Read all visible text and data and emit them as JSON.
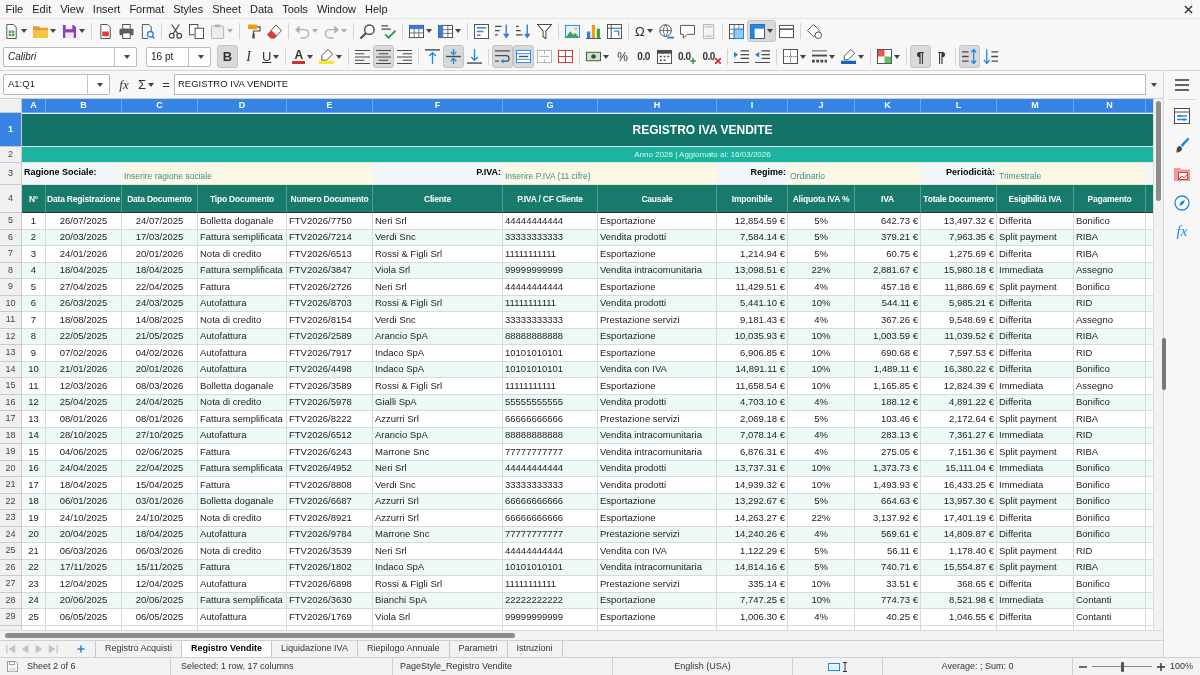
{
  "menu_bar": [
    "File",
    "Edit",
    "View",
    "Insert",
    "Format",
    "Styles",
    "Sheet",
    "Data",
    "Tools",
    "Window",
    "Help"
  ],
  "standard_toolbar": {
    "groups": [
      [
        {
          "kind": "new",
          "on": false,
          "disabled": false
        },
        {
          "kind": "open",
          "on": false,
          "disabled": false
        },
        {
          "kind": "save",
          "on": false,
          "disabled": false
        }
      ],
      [
        {
          "kind": "export-pdf",
          "on": false,
          "disabled": false
        },
        {
          "kind": "print",
          "on": false,
          "disabled": false
        },
        {
          "kind": "print-preview",
          "on": false,
          "disabled": false
        }
      ],
      [
        {
          "kind": "cut",
          "on": false,
          "disabled": false
        },
        {
          "kind": "copy",
          "on": false,
          "disabled": false
        },
        {
          "kind": "paste",
          "on": false,
          "disabled": true
        }
      ],
      [
        {
          "kind": "clone-formatting",
          "on": false,
          "disabled": false
        },
        {
          "kind": "clear-formatting",
          "on": false,
          "disabled": false
        }
      ],
      [
        {
          "kind": "undo",
          "on": false,
          "disabled": true
        },
        {
          "kind": "redo",
          "on": false,
          "disabled": true
        }
      ],
      [
        {
          "kind": "find-replace",
          "on": false,
          "disabled": false
        },
        {
          "kind": "spelling",
          "on": false,
          "disabled": false
        }
      ],
      [
        {
          "kind": "rows",
          "on": false,
          "disabled": false
        },
        {
          "kind": "columns",
          "on": false,
          "disabled": false
        }
      ],
      [
        {
          "kind": "sort",
          "on": false,
          "disabled": false
        },
        {
          "kind": "sort-ascending",
          "on": false,
          "disabled": false
        },
        {
          "kind": "sort-descending",
          "on": false,
          "disabled": false
        },
        {
          "kind": "autofilter",
          "on": false,
          "disabled": false
        }
      ],
      [
        {
          "kind": "image",
          "on": false,
          "disabled": false
        },
        {
          "kind": "chart",
          "on": false,
          "disabled": false
        },
        {
          "kind": "pivot-table",
          "on": false,
          "disabled": false
        }
      ],
      [
        {
          "kind": "special-character",
          "glyph": "Ω",
          "on": false,
          "disabled": false
        },
        {
          "kind": "hyperlink",
          "on": false,
          "disabled": false
        },
        {
          "kind": "comment",
          "on": false,
          "disabled": false
        },
        {
          "kind": "headers-footers",
          "on": false,
          "disabled": true
        }
      ],
      [
        {
          "kind": "print-area",
          "on": false,
          "disabled": false
        },
        {
          "kind": "freeze",
          "on": true,
          "disabled": false
        },
        {
          "kind": "split-window",
          "on": false,
          "disabled": false
        }
      ],
      [
        {
          "kind": "draw-functions",
          "on": false,
          "disabled": false
        }
      ]
    ]
  },
  "formatting_toolbar": {
    "font_name": "Calibri",
    "font_size": "16 pt",
    "groups": [
      [
        {
          "kind": "bold",
          "glyph": "B",
          "on": true,
          "disabled": false
        },
        {
          "kind": "italic",
          "glyph": "I",
          "on": false,
          "disabled": false
        },
        {
          "kind": "underline",
          "glyph": "U",
          "on": false,
          "disabled": false
        }
      ],
      [
        {
          "kind": "font-color",
          "glyph": "A",
          "on": false,
          "disabled": false
        },
        {
          "kind": "highlight",
          "on": false,
          "disabled": false
        }
      ],
      [
        {
          "kind": "align-left",
          "on": false,
          "disabled": false
        },
        {
          "kind": "align-center",
          "on": true,
          "disabled": false
        },
        {
          "kind": "align-right",
          "on": false,
          "disabled": false
        }
      ],
      [
        {
          "kind": "align-top",
          "on": false,
          "disabled": false
        },
        {
          "kind": "align-middle",
          "on": true,
          "disabled": false
        },
        {
          "kind": "align-bottom",
          "on": false,
          "disabled": false
        }
      ],
      [
        {
          "kind": "wrap-text",
          "on": true,
          "disabled": false
        },
        {
          "kind": "merge-center",
          "on": true,
          "disabled": false
        },
        {
          "kind": "merge-cells",
          "on": false,
          "disabled": true
        },
        {
          "kind": "unmerge-cells",
          "on": false,
          "disabled": false
        }
      ],
      [
        {
          "kind": "currency",
          "on": false,
          "disabled": false
        },
        {
          "kind": "percent",
          "glyph": "%",
          "on": false,
          "disabled": false
        },
        {
          "kind": "number-format",
          "glyph": "0.0",
          "on": false,
          "disabled": false
        },
        {
          "kind": "date-format",
          "on": false,
          "disabled": false
        },
        {
          "kind": "add-decimal",
          "glyph": "0.0",
          "on": false,
          "disabled": false
        },
        {
          "kind": "delete-decimal",
          "glyph": "0.0",
          "on": false,
          "disabled": false
        }
      ],
      [
        {
          "kind": "increase-indent",
          "on": false,
          "disabled": false
        },
        {
          "kind": "decrease-indent",
          "on": false,
          "disabled": false
        }
      ],
      [
        {
          "kind": "borders",
          "on": false,
          "disabled": false
        },
        {
          "kind": "border-style",
          "on": false,
          "disabled": false
        },
        {
          "kind": "border-color",
          "on": false,
          "disabled": false
        }
      ],
      [
        {
          "kind": "conditional",
          "on": false,
          "disabled": false
        }
      ],
      [
        {
          "kind": "left-to-right",
          "glyph": "¶",
          "on": true,
          "disabled": false
        },
        {
          "kind": "right-to-left",
          "glyph": "¶",
          "on": false,
          "disabled": false
        }
      ],
      [
        {
          "kind": "text-stack",
          "on": true,
          "disabled": false
        },
        {
          "kind": "text-down",
          "on": false,
          "disabled": false
        }
      ]
    ]
  },
  "formula_bar": {
    "name_box": "A1:Q1",
    "buttons": [
      {
        "kind": "function-wizard",
        "glyph": "fx"
      },
      {
        "kind": "sum",
        "glyph": "Σ"
      },
      {
        "kind": "formula",
        "glyph": "="
      }
    ],
    "content": "REGISTRO IVA VENDITE"
  },
  "sheet": {
    "column_headers": [
      {
        "label": "A",
        "selected": true
      },
      {
        "label": "B",
        "selected": true
      },
      {
        "label": "C",
        "selected": true
      },
      {
        "label": "D",
        "selected": true
      },
      {
        "label": "E",
        "selected": true
      },
      {
        "label": "F",
        "selected": true
      },
      {
        "label": "G",
        "selected": true
      },
      {
        "label": "H",
        "selected": true
      },
      {
        "label": "I",
        "selected": true
      },
      {
        "label": "J",
        "selected": true
      },
      {
        "label": "K",
        "selected": true
      },
      {
        "label": "L",
        "selected": true
      },
      {
        "label": "M",
        "selected": true
      },
      {
        "label": "N",
        "selected": true
      }
    ],
    "row_headers": [
      {
        "label": "1",
        "selected": true
      },
      {
        "label": "2",
        "selected": false
      },
      {
        "label": "3",
        "selected": false
      },
      {
        "label": "4",
        "selected": false
      },
      {
        "label": "5",
        "selected": false
      },
      {
        "label": "6",
        "selected": false
      },
      {
        "label": "7",
        "selected": false
      },
      {
        "label": "8",
        "selected": false
      },
      {
        "label": "9",
        "selected": false
      },
      {
        "label": "10",
        "selected": false
      },
      {
        "label": "11",
        "selected": false
      },
      {
        "label": "12",
        "selected": false
      },
      {
        "label": "13",
        "selected": false
      },
      {
        "label": "14",
        "selected": false
      },
      {
        "label": "15",
        "selected": false
      },
      {
        "label": "16",
        "selected": false
      },
      {
        "label": "17",
        "selected": false
      },
      {
        "label": "18",
        "selected": false
      },
      {
        "label": "19",
        "selected": false
      },
      {
        "label": "20",
        "selected": false
      },
      {
        "label": "21",
        "selected": false
      },
      {
        "label": "22",
        "selected": false
      },
      {
        "label": "23",
        "selected": false
      },
      {
        "label": "24",
        "selected": false
      },
      {
        "label": "25",
        "selected": false
      },
      {
        "label": "26",
        "selected": false
      },
      {
        "label": "27",
        "selected": false
      },
      {
        "label": "28",
        "selected": false
      },
      {
        "label": "29",
        "selected": false
      }
    ],
    "title": "REGISTRO IVA VENDITE",
    "subtitle": "Anno 2026 | Aggiornato al: 16/03/2026",
    "info_fields": [
      {
        "label": "Ragione Sociale:",
        "value": "Inserire ragione sociale"
      },
      {
        "label": "P.IVA:",
        "value": "Inserire P.IVA (11 cifre)"
      },
      {
        "label": "Regime:",
        "value": "Ordinario"
      },
      {
        "label": "Periodicità:",
        "value": "Trimestrale"
      }
    ],
    "columns": [
      "N°",
      "Data Registrazione",
      "Data Documento",
      "Tipo Documento",
      "Numero Documento",
      "Cliente",
      "P.IVA / CF Cliente",
      "Causale",
      "Imponibile",
      "Aliquota IVA %",
      "IVA",
      "Totale Documento",
      "Esigibilità IVA",
      "Pagamento"
    ],
    "rows": [
      [
        "1",
        "26/07/2025",
        "24/07/2025",
        "Bolletta doganale",
        "FTV2026/7750",
        "Neri Srl",
        "44444444444",
        "Esportazione",
        "12,854.59 €",
        "5%",
        "642.73 €",
        "13,497.32 €",
        "Differita",
        "Bonifico"
      ],
      [
        "2",
        "20/03/2025",
        "17/03/2025",
        "Fattura semplificata",
        "FTV2026/7214",
        "Verdi Snc",
        "33333333333",
        "Vendita prodotti",
        "7,584.14 €",
        "5%",
        "379.21 €",
        "7,963.35 €",
        "Split payment",
        "RIBA"
      ],
      [
        "3",
        "24/01/2026",
        "20/01/2026",
        "Nota di credito",
        "FTV2026/6513",
        "Rossi & Figli Srl",
        "11111111111",
        "Esportazione",
        "1,214.94 €",
        "5%",
        "60.75 €",
        "1,275.69 €",
        "Differita",
        "RIBA"
      ],
      [
        "4",
        "18/04/2025",
        "18/04/2025",
        "Fattura semplificata",
        "FTV2026/3847",
        "Viola Srl",
        "99999999999",
        "Vendita intracomunitaria",
        "13,098.51 €",
        "22%",
        "2,881.67 €",
        "15,980.18 €",
        "Immediata",
        "Assegno"
      ],
      [
        "5",
        "27/04/2025",
        "22/04/2025",
        "Fattura",
        "FTV2026/2726",
        "Neri Srl",
        "44444444444",
        "Esportazione",
        "11,429.51 €",
        "4%",
        "457.18 €",
        "11,886.69 €",
        "Split payment",
        "Bonifico"
      ],
      [
        "6",
        "26/03/2025",
        "24/03/2025",
        "Autofattura",
        "FTV2026/8703",
        "Rossi & Figli Srl",
        "11111111111",
        "Vendita prodotti",
        "5,441.10 €",
        "10%",
        "544.11 €",
        "5,985.21 €",
        "Differita",
        "RID"
      ],
      [
        "7",
        "18/08/2025",
        "14/08/2025",
        "Nota di credito",
        "FTV2026/8154",
        "Verdi Snc",
        "33333333333",
        "Prestazione servizi",
        "9,181.43 €",
        "4%",
        "367.26 €",
        "9,548.69 €",
        "Differita",
        "Assegno"
      ],
      [
        "8",
        "22/05/2025",
        "21/05/2025",
        "Autofattura",
        "FTV2026/2589",
        "Arancio SpA",
        "88888888888",
        "Esportazione",
        "10,035.93 €",
        "10%",
        "1,003.59 €",
        "11,039.52 €",
        "Differita",
        "RIBA"
      ],
      [
        "9",
        "07/02/2026",
        "04/02/2026",
        "Autofattura",
        "FTV2026/7917",
        "Indaco SpA",
        "10101010101",
        "Esportazione",
        "6,906.85 €",
        "10%",
        "690.68 €",
        "7,597.53 €",
        "Differita",
        "RID"
      ],
      [
        "10",
        "21/01/2026",
        "20/01/2026",
        "Autofattura",
        "FTV2026/4498",
        "Indaco SpA",
        "10101010101",
        "Vendita con IVA",
        "14,891.11 €",
        "10%",
        "1,489.11 €",
        "16,380.22 €",
        "Differita",
        "Bonifico"
      ],
      [
        "11",
        "12/03/2026",
        "08/03/2026",
        "Bolletta doganale",
        "FTV2026/3589",
        "Rossi & Figli Srl",
        "11111111111",
        "Esportazione",
        "11,658.54 €",
        "10%",
        "1,165.85 €",
        "12,824.39 €",
        "Immediata",
        "Assegno"
      ],
      [
        "12",
        "25/04/2025",
        "24/04/2025",
        "Nota di credito",
        "FTV2026/5978",
        "Gialli SpA",
        "55555555555",
        "Vendita prodotti",
        "4,703.10 €",
        "4%",
        "188.12 €",
        "4,891.22 €",
        "Differita",
        "Bonifico"
      ],
      [
        "13",
        "08/01/2026",
        "08/01/2026",
        "Fattura semplificata",
        "FTV2026/8222",
        "Azzurri Srl",
        "66666666666",
        "Prestazione servizi",
        "2,069.18 €",
        "5%",
        "103.46 €",
        "2,172.64 €",
        "Split payment",
        "RIBA"
      ],
      [
        "14",
        "28/10/2025",
        "27/10/2025",
        "Autofattura",
        "FTV2026/6512",
        "Arancio SpA",
        "88888888888",
        "Vendita intracomunitaria",
        "7,078.14 €",
        "4%",
        "283.13 €",
        "7,361.27 €",
        "Immediata",
        "RID"
      ],
      [
        "15",
        "04/06/2025",
        "02/06/2025",
        "Fattura",
        "FTV2026/6243",
        "Marrone Snc",
        "77777777777",
        "Vendita intracomunitaria",
        "6,876.31 €",
        "4%",
        "275.05 €",
        "7,151.36 €",
        "Split payment",
        "RIBA"
      ],
      [
        "16",
        "24/04/2025",
        "22/04/2025",
        "Fattura semplificata",
        "FTV2026/4952",
        "Neri Srl",
        "44444444444",
        "Vendita prodotti",
        "13,737.31 €",
        "10%",
        "1,373.73 €",
        "15,111.04 €",
        "Immediata",
        "Bonifico"
      ],
      [
        "17",
        "18/04/2025",
        "15/04/2025",
        "Fattura",
        "FTV2026/8808",
        "Verdi Snc",
        "33333333333",
        "Vendita prodotti",
        "14,939.32 €",
        "10%",
        "1,493.93 €",
        "16,433.25 €",
        "Immediata",
        "Bonifico"
      ],
      [
        "18",
        "06/01/2026",
        "03/01/2026",
        "Bolletta doganale",
        "FTV2026/6687",
        "Azzurri Srl",
        "66666666666",
        "Esportazione",
        "13,292.67 €",
        "5%",
        "664.63 €",
        "13,957.30 €",
        "Split payment",
        "Bonifico"
      ],
      [
        "19",
        "24/10/2025",
        "24/10/2025",
        "Nota di credito",
        "FTV2026/8921",
        "Azzurri Srl",
        "66666666666",
        "Esportazione",
        "14,263.27 €",
        "22%",
        "3,137.92 €",
        "17,401.19 €",
        "Differita",
        "Bonifico"
      ],
      [
        "20",
        "20/04/2025",
        "18/04/2025",
        "Autofattura",
        "FTV2026/9784",
        "Marrone Snc",
        "77777777777",
        "Prestazione servizi",
        "14,240.26 €",
        "4%",
        "569.61 €",
        "14,809.87 €",
        "Differita",
        "Bonifico"
      ],
      [
        "21",
        "06/03/2026",
        "06/03/2026",
        "Nota di credito",
        "FTV2026/3539",
        "Neri Srl",
        "44444444444",
        "Vendita con IVA",
        "1,122.29 €",
        "5%",
        "56.11 €",
        "1,178.40 €",
        "Split payment",
        "RID"
      ],
      [
        "22",
        "17/11/2025",
        "15/11/2025",
        "Fattura",
        "FTV2026/1802",
        "Indaco SpA",
        "10101010101",
        "Vendita intracomunitaria",
        "14,814.16 €",
        "5%",
        "740.71 €",
        "15,554.87 €",
        "Split payment",
        "RIBA"
      ],
      [
        "23",
        "12/04/2025",
        "12/04/2025",
        "Autofattura",
        "FTV2026/6898",
        "Rossi & Figli Srl",
        "11111111111",
        "Prestazione servizi",
        "335.14 €",
        "10%",
        "33.51 €",
        "368.65 €",
        "Differita",
        "Bonifico"
      ],
      [
        "24",
        "20/06/2025",
        "20/06/2025",
        "Fattura semplificata",
        "FTV2026/3630",
        "Bianchi SpA",
        "22222222222",
        "Esportazione",
        "7,747.25 €",
        "10%",
        "774.73 €",
        "8,521.98 €",
        "Immediata",
        "Contanti"
      ],
      [
        "25",
        "06/05/2025",
        "06/05/2025",
        "Autofattura",
        "FTV2026/1769",
        "Viola Srl",
        "99999999999",
        "Esportazione",
        "1,006.30 €",
        "4%",
        "40.25 €",
        "1,046.55 €",
        "Differita",
        "Contanti"
      ]
    ]
  },
  "sheet_navigation": [
    {
      "kind": "first",
      "disabled": true
    },
    {
      "kind": "previous",
      "disabled": true
    },
    {
      "kind": "next",
      "disabled": true
    },
    {
      "kind": "last",
      "disabled": true
    }
  ],
  "sheet_tabs": [
    {
      "label": "Registro Acquisti",
      "selected": false
    },
    {
      "label": "Registro Vendite",
      "selected": true
    },
    {
      "label": "Liquidazione IVA",
      "selected": false
    },
    {
      "label": "Riepilogo Annuale",
      "selected": false
    },
    {
      "label": "Parametri",
      "selected": false
    },
    {
      "label": "Istruzioni",
      "selected": false
    }
  ],
  "sidebar": {
    "items": [
      {
        "kind": "menu"
      },
      {
        "kind": "properties"
      },
      {
        "kind": "styles"
      },
      {
        "kind": "gallery"
      },
      {
        "kind": "navigator"
      },
      {
        "kind": "functions",
        "glyph": "fx"
      }
    ]
  },
  "status_bar": {
    "sheet": "Sheet 2 of 6",
    "selection": "Selected: 1 row, 17 columns",
    "page_style": "PageStyle_Registro Vendite",
    "language": "English (USA)",
    "summary": "Average: ; Sum: 0",
    "zoom": {
      "level": 0.5,
      "reading": "100%"
    }
  }
}
